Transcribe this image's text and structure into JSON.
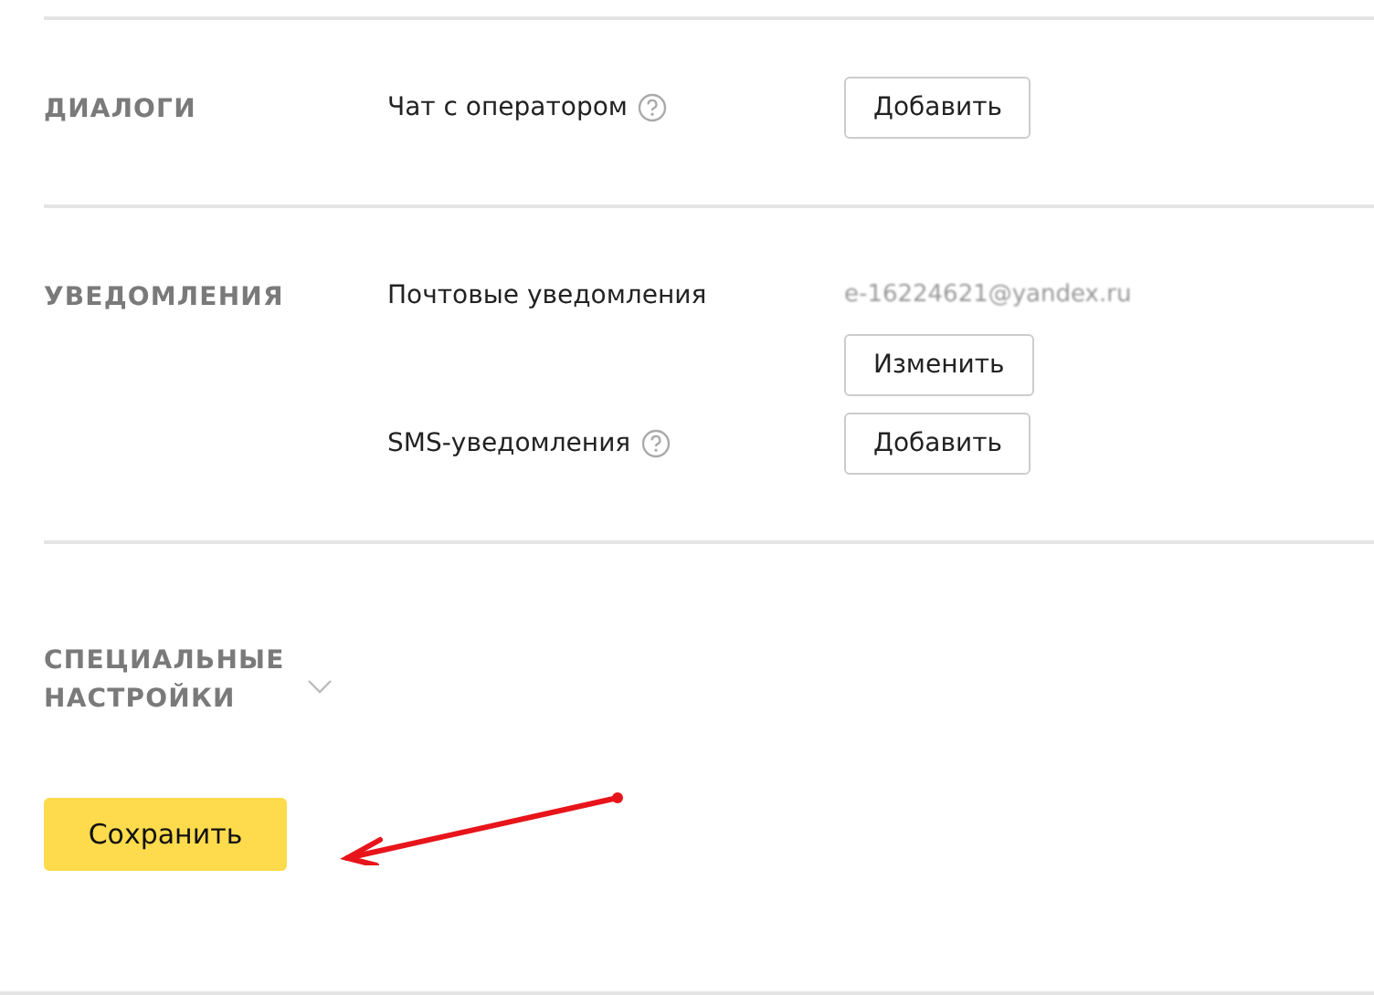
{
  "sections": [
    {
      "title": "ДИАЛОГИ",
      "rows": [
        {
          "label": "Чат с оператором",
          "help": true,
          "button": "Добавить"
        }
      ]
    },
    {
      "title": "УВЕДОМЛЕНИЯ",
      "rows": [
        {
          "label": "Почтовые уведомления",
          "help": false,
          "value": "e-16224621@yandex.ru",
          "button": "Изменить"
        },
        {
          "label": "SMS-уведомления",
          "help": true,
          "button": "Добавить"
        }
      ]
    }
  ],
  "special": {
    "title": "СПЕЦИАЛЬНЫЕ НАСТРОЙКИ",
    "expanded": false
  },
  "save_button": "Сохранить"
}
